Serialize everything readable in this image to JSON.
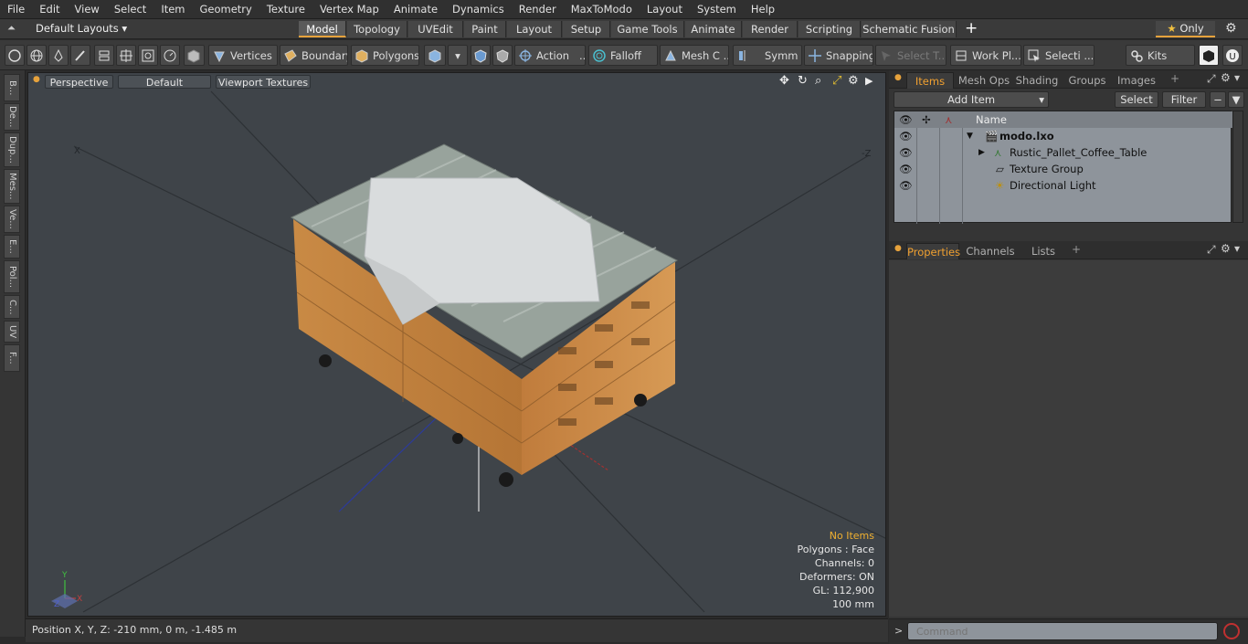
{
  "menu": [
    "File",
    "Edit",
    "View",
    "Select",
    "Item",
    "Geometry",
    "Texture",
    "Vertex Map",
    "Animate",
    "Dynamics",
    "Render",
    "MaxToModo",
    "Layout",
    "System",
    "Help"
  ],
  "layouts": {
    "dropdown": "Default Layouts",
    "tabs": [
      "Model",
      "Topology",
      "UVEdit",
      "Paint",
      "Layout",
      "Setup",
      "Game Tools",
      "Animate",
      "Render",
      "Scripting",
      "Schematic Fusion"
    ],
    "active": "Model",
    "plus": "+",
    "only_label": "Only"
  },
  "toolbar": {
    "vertices": "Vertices",
    "boundary": "Boundary",
    "polygons": "Polygons",
    "action": "Action",
    "falloff": "Falloff",
    "mesh": "Mesh C ...",
    "symm": "Symm ...",
    "snapping": "Snapping",
    "select_t": "Select T...",
    "workpl": "Work Pl...",
    "selecti": "Selecti ...",
    "kits": "Kits",
    "ellipsis": "..."
  },
  "left_tabs": [
    "B...",
    "De...",
    "Dup...",
    "Mes...",
    "Ve...",
    "E...",
    "Pol...",
    "C...",
    "UV",
    "F..."
  ],
  "viewport": {
    "perspective": "Perspective",
    "default": "Default",
    "textures": "Viewport Textures",
    "info": {
      "no_items": "No Items",
      "polygons": "Polygons : Face",
      "channels": "Channels: 0",
      "deformers": "Deformers: ON",
      "gl": "GL: 112,900",
      "scale": "100 mm"
    },
    "axis": {
      "x": "X",
      "y": "Y",
      "z": "Z"
    }
  },
  "status": {
    "position": "Position X, Y, Z:   -210 mm, 0 m, -1.485 m"
  },
  "items_panel": {
    "tabs": [
      "Items",
      "Mesh Ops",
      "Shading",
      "Groups",
      "Images"
    ],
    "active_tab": "Items",
    "plus": "+",
    "add_item": "Add Item",
    "select": "Select",
    "filter": "Filter",
    "name_header": "Name",
    "rows": [
      "modo.lxo",
      "Rustic_Pallet_Coffee_Table",
      "Texture Group",
      "Directional Light"
    ]
  },
  "props_panel": {
    "tabs": [
      "Properties",
      "Channels",
      "Lists"
    ],
    "active_tab": "Properties",
    "plus": "+"
  },
  "command": {
    "placeholder": "Command",
    "prompt": ">"
  },
  "colors": {
    "accent": "#e6a23c",
    "viewport_bg": "#3f4449",
    "list_bg": "#8e949b"
  }
}
